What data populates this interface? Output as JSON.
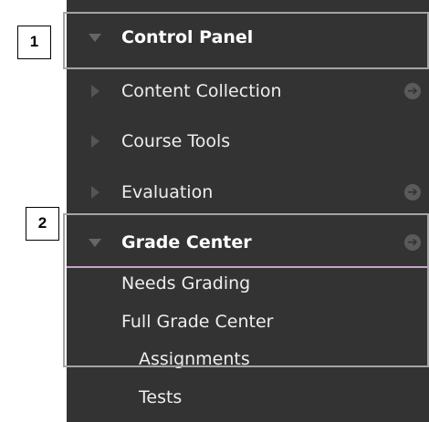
{
  "menu": {
    "control_panel": "Control Panel",
    "items": [
      {
        "label": "Content Collection"
      },
      {
        "label": "Course Tools"
      },
      {
        "label": "Evaluation"
      },
      {
        "label": "Grade Center"
      }
    ],
    "grade_center_sub": [
      "Needs Grading",
      "Full Grade Center",
      "Assignments",
      "Tests"
    ]
  },
  "callouts": [
    "1",
    "2"
  ],
  "icons": {
    "expand": "triangle-down-icon",
    "collapse": "triangle-right-icon",
    "go": "circle-arrow-right-icon"
  },
  "colors": {
    "panel_bg": "#333333",
    "text": "#eeeeee",
    "active_divider": "#c9a3c8",
    "frame": "#a5a5a5"
  }
}
